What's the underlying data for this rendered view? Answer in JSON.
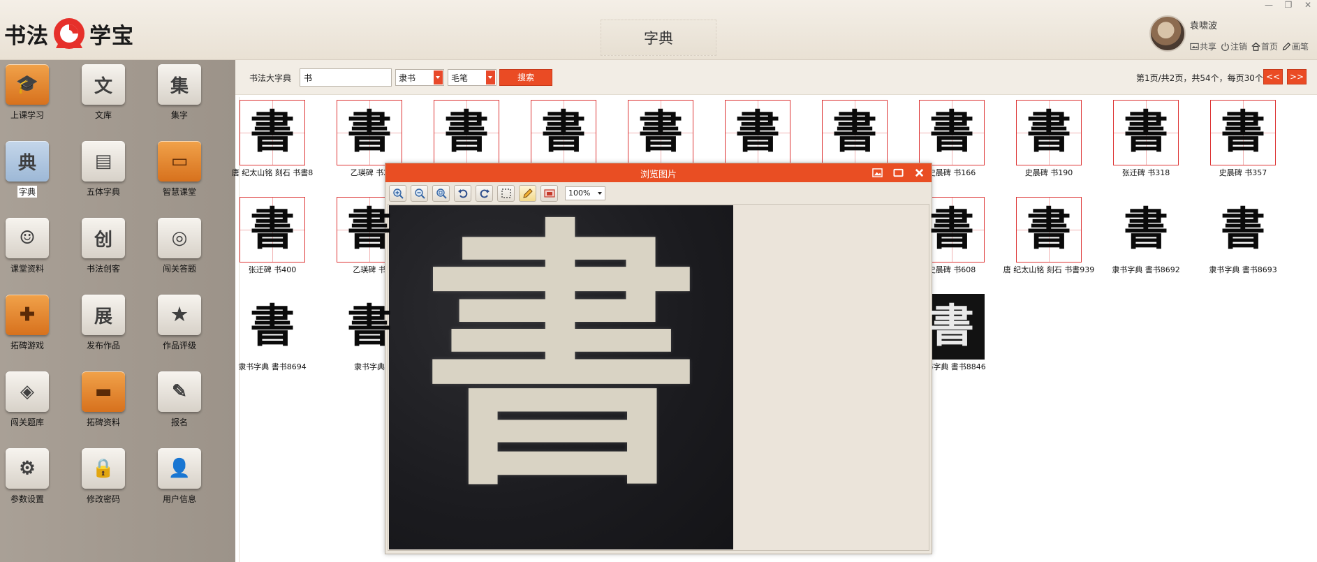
{
  "header": {
    "logo_left": "书法",
    "logo_right": "学宝",
    "title": "字典",
    "username": "袁啸波",
    "links": [
      {
        "icon": "image-icon",
        "label": "共享"
      },
      {
        "icon": "power-icon",
        "label": "注销"
      },
      {
        "icon": "home-icon",
        "label": "首页"
      },
      {
        "icon": "pencil-icon",
        "label": "画笔"
      }
    ],
    "window_controls": [
      "—",
      "❐",
      "✕"
    ]
  },
  "sidebar": {
    "items": [
      {
        "label": "上课学习",
        "glyph": "🎓",
        "style": "orange",
        "icon": "graduation-cap-icon"
      },
      {
        "label": "文库",
        "glyph": "文",
        "style": "gray",
        "icon": "library-icon"
      },
      {
        "label": "集字",
        "glyph": "集",
        "style": "gray",
        "icon": "collect-characters-icon"
      },
      {
        "label": "字典",
        "glyph": "典",
        "style": "blue",
        "icon": "dictionary-icon",
        "selected": true
      },
      {
        "label": "五体字典",
        "glyph": "▤",
        "style": "gray",
        "icon": "five-styles-book-icon"
      },
      {
        "label": "智慧课堂",
        "glyph": "▭",
        "style": "orange",
        "icon": "smart-classroom-icon"
      },
      {
        "label": "课堂资料",
        "glyph": "☺",
        "style": "gray",
        "icon": "people-group-icon"
      },
      {
        "label": "书法创客",
        "glyph": "创",
        "style": "gray",
        "icon": "create-icon"
      },
      {
        "label": "闯关答题",
        "glyph": "◎",
        "style": "gray",
        "icon": "quiz-challenge-icon"
      },
      {
        "label": "拓碑游戏",
        "glyph": "✚",
        "style": "orange",
        "icon": "gamepad-icon"
      },
      {
        "label": "发布作品",
        "glyph": "展",
        "style": "gray",
        "icon": "exhibit-icon"
      },
      {
        "label": "作品评级",
        "glyph": "★",
        "style": "gray",
        "icon": "star-rating-icon"
      },
      {
        "label": "闯关题库",
        "glyph": "◈",
        "style": "gray",
        "icon": "layers-icon"
      },
      {
        "label": "拓碑资料",
        "glyph": "▬",
        "style": "orange",
        "icon": "book-icon"
      },
      {
        "label": "报名",
        "glyph": "✎",
        "style": "gray",
        "icon": "edit-form-icon"
      },
      {
        "label": "参数设置",
        "glyph": "⚙",
        "style": "gray",
        "icon": "settings-gear-icon"
      },
      {
        "label": "修改密码",
        "glyph": "🔒",
        "style": "gray",
        "icon": "lock-icon"
      },
      {
        "label": "用户信息",
        "glyph": "👤",
        "style": "gray",
        "icon": "user-icon"
      }
    ]
  },
  "toolbar": {
    "label": "书法大字典",
    "search_value": "书",
    "style_value": "隶书",
    "tool_value": "毛笔",
    "search_button": "搜索",
    "page_info": "第1页/共2页，共54个，每页30个",
    "prev_label": "<<",
    "next_label": ">>"
  },
  "results": [
    {
      "caption": "唐 纪太山铭 刻石 书書8",
      "char": "書",
      "bordered": true
    },
    {
      "caption": "乙瑛碑 书2",
      "char": "書",
      "bordered": true
    },
    {
      "caption": "",
      "char": "書",
      "bordered": true
    },
    {
      "caption": "",
      "char": "書",
      "bordered": true
    },
    {
      "caption": "",
      "char": "書",
      "bordered": true
    },
    {
      "caption": "",
      "char": "書",
      "bordered": true
    },
    {
      "caption": "",
      "char": "書",
      "bordered": true
    },
    {
      "caption": "史晨碑 书166",
      "char": "書",
      "bordered": true
    },
    {
      "caption": "史晨碑 书190",
      "char": "書",
      "bordered": true
    },
    {
      "caption": "张迁碑 书318",
      "char": "書",
      "bordered": true
    },
    {
      "caption": "史晨碑 书357",
      "char": "書",
      "bordered": true
    },
    {
      "caption": "张迁碑 书400",
      "char": "書",
      "bordered": true
    },
    {
      "caption": "乙瑛碑 书",
      "char": "書",
      "bordered": true
    },
    {
      "caption": "",
      "char": "",
      "bordered": false
    },
    {
      "caption": "",
      "char": "",
      "bordered": false
    },
    {
      "caption": "",
      "char": "",
      "bordered": false
    },
    {
      "caption": "",
      "char": "",
      "bordered": false
    },
    {
      "caption": "",
      "char": "",
      "bordered": false
    },
    {
      "caption": "史晨碑 书608",
      "char": "書",
      "bordered": true
    },
    {
      "caption": "唐 纪太山铭 刻石 书書939",
      "char": "書",
      "bordered": true
    },
    {
      "caption": "隶书字典 書书8692",
      "char": "書",
      "bordered": false
    },
    {
      "caption": "隶书字典 書书8693",
      "char": "書",
      "bordered": false
    },
    {
      "caption": "隶书字典 書书8694",
      "char": "書",
      "bordered": false
    },
    {
      "caption": "隶书字典",
      "char": "書",
      "bordered": false
    },
    {
      "caption": "",
      "char": "",
      "bordered": false
    },
    {
      "caption": "",
      "char": "",
      "bordered": false
    },
    {
      "caption": "",
      "char": "",
      "bordered": false
    },
    {
      "caption": "",
      "char": "",
      "bordered": false
    },
    {
      "caption": "",
      "char": "",
      "bordered": false
    },
    {
      "caption": "隶书字典 書书8846",
      "char": "書",
      "bordered": false,
      "dark": true
    }
  ],
  "viewer": {
    "title": "浏览图片",
    "zoom": "100%",
    "image_char": "書",
    "tools": [
      "zoom-in-icon",
      "zoom-out-icon",
      "zoom-fit-icon",
      "rotate-left-icon",
      "rotate-right-icon",
      "select-area-icon",
      "pencil-icon",
      "save-image-icon"
    ]
  }
}
